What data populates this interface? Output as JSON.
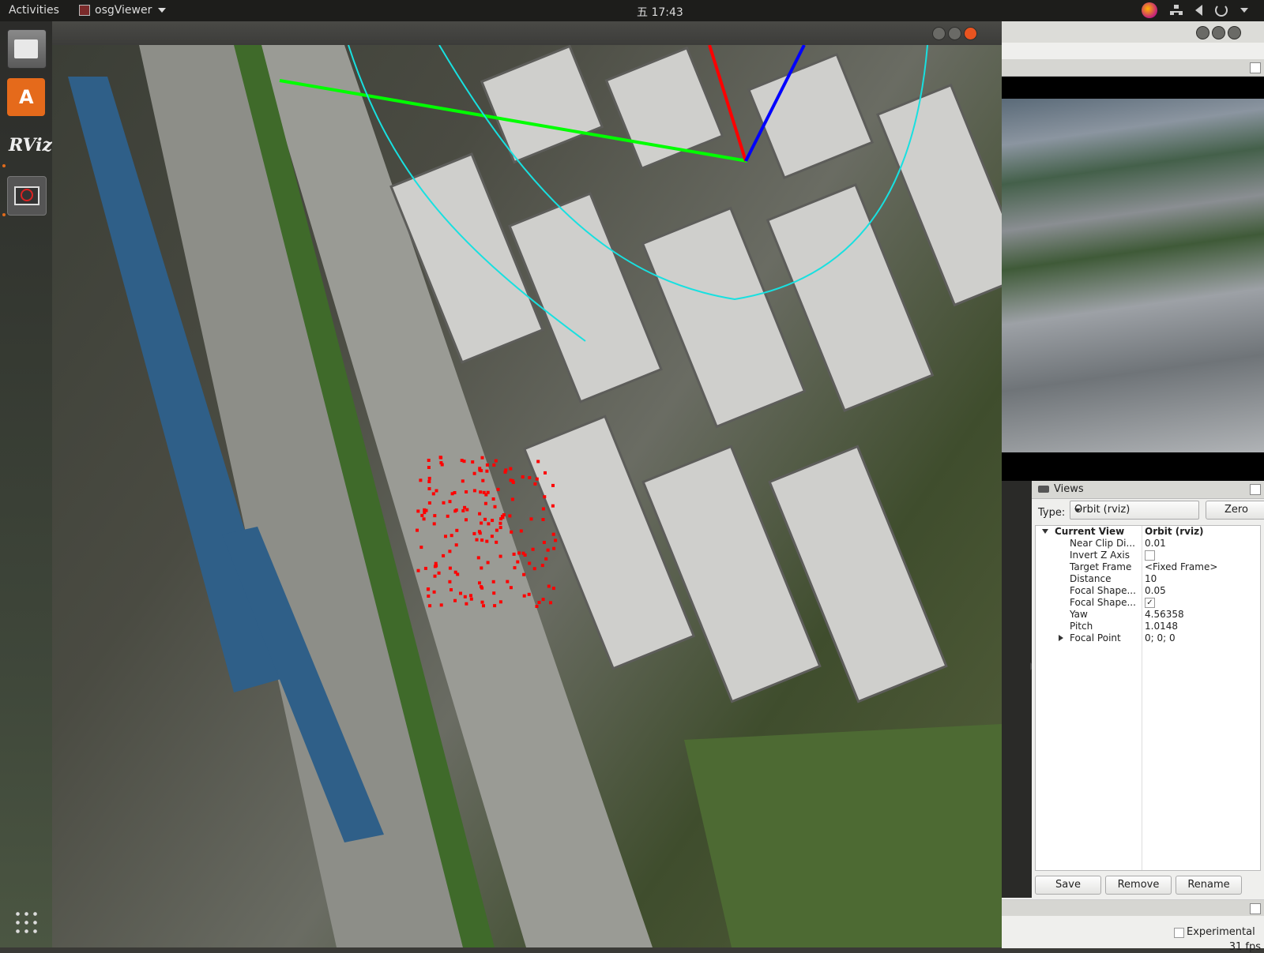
{
  "topbar": {
    "activities": "Activities",
    "app_name": "osgViewer",
    "clock": "五 17:43"
  },
  "dock": {
    "items": [
      "files-icon",
      "software-store-icon",
      "rviz-icon",
      "osgviewer-icon"
    ],
    "rviz_label": "RViz",
    "store_label": "A"
  },
  "osg_window": {
    "overlay_colors": {
      "x_axis": "#ff0000",
      "y_axis": "#00ff00",
      "z_axis": "#0000ff",
      "trajectory": "#18e0e0",
      "points": "#ff0000"
    }
  },
  "rviz": {
    "views": {
      "title": "Views",
      "type_label": "Type:",
      "type_value": "Orbit (rviz)",
      "zero_button": "Zero",
      "current_view": {
        "name": "Current View",
        "value": "Orbit (rviz)"
      },
      "properties": [
        {
          "name": "Near Clip Di...",
          "value": "0.01"
        },
        {
          "name": "Invert Z Axis",
          "value": "",
          "checkbox": false
        },
        {
          "name": "Target Frame",
          "value": "<Fixed Frame>"
        },
        {
          "name": "Distance",
          "value": "10"
        },
        {
          "name": "Focal Shape...",
          "value": "0.05"
        },
        {
          "name": "Focal Shape...",
          "value": "",
          "checkbox": true
        },
        {
          "name": "Yaw",
          "value": "4.56358"
        },
        {
          "name": "Pitch",
          "value": "1.0148"
        },
        {
          "name": "Focal Point",
          "value": "0; 0; 0"
        }
      ],
      "save_button": "Save",
      "remove_button": "Remove",
      "rename_button": "Rename"
    },
    "experimental_label": "Experimental",
    "fps": "31 fps"
  }
}
